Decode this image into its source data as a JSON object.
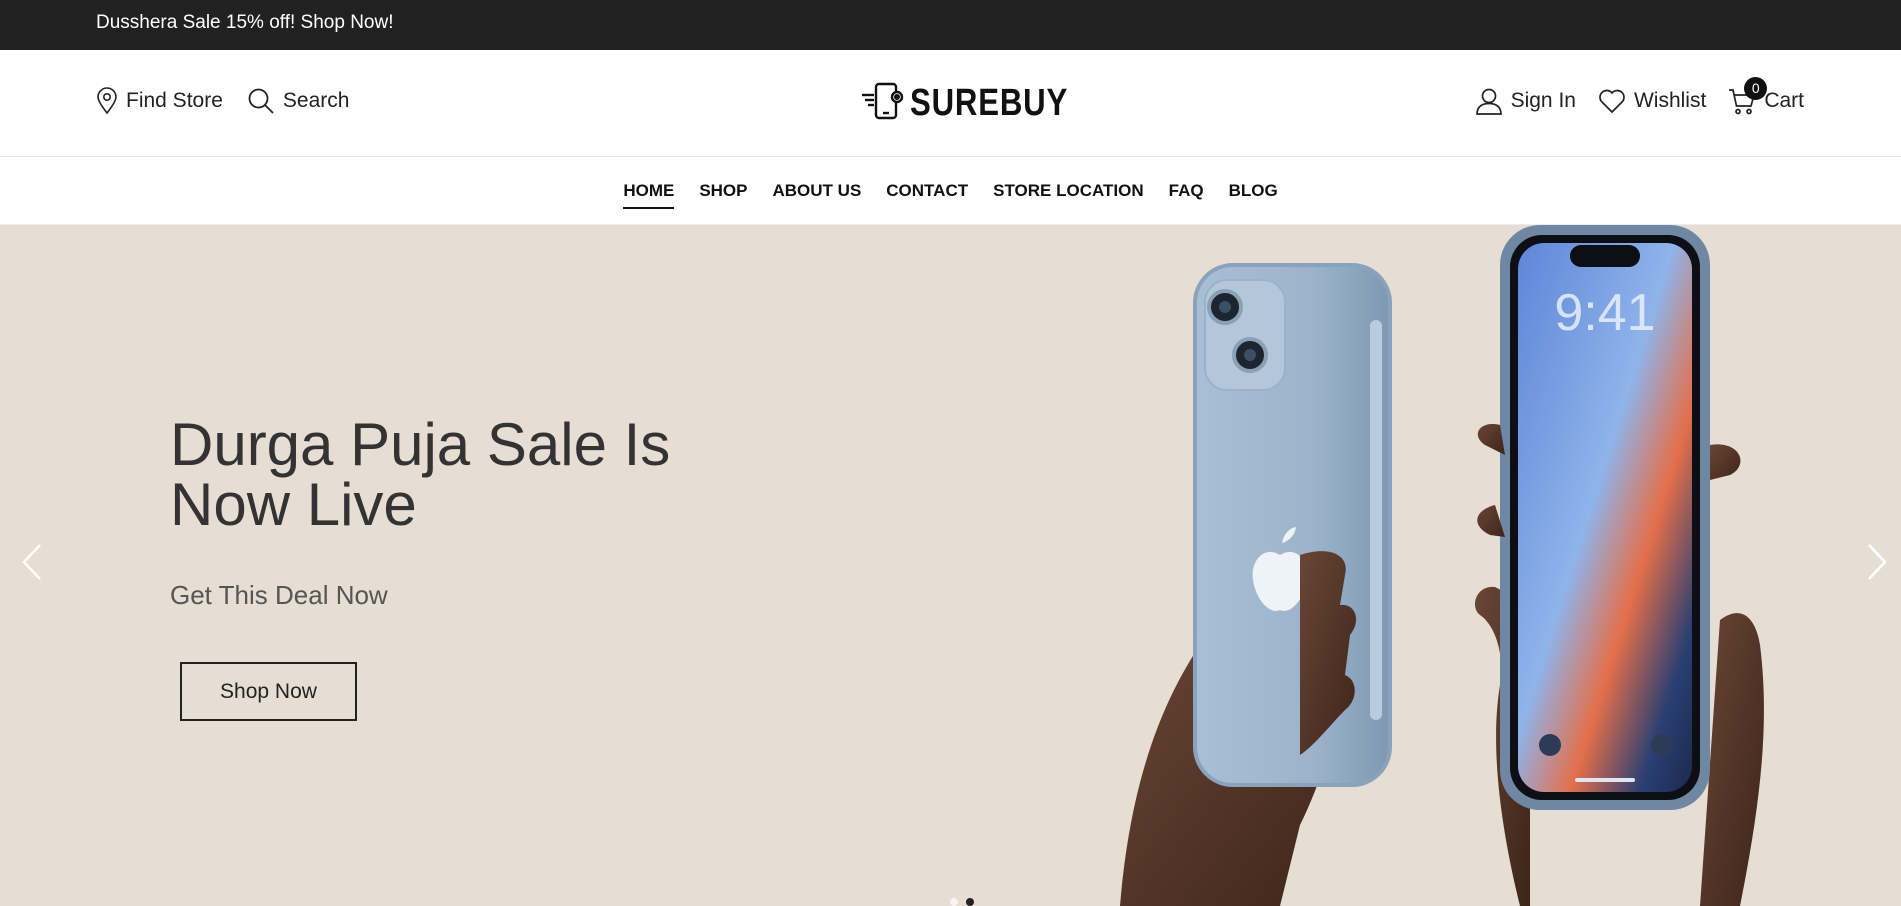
{
  "announcement": {
    "text": "Dusshera Sale 15% off! Shop Now!"
  },
  "header": {
    "find_store": "Find Store",
    "search": "Search",
    "logo_text": "SUREBUY",
    "sign_in": "Sign In",
    "wishlist": "Wishlist",
    "cart": "Cart",
    "cart_count": "0"
  },
  "nav": {
    "items": [
      "HOME",
      "SHOP",
      "ABOUT US",
      "CONTACT",
      "STORE LOCATION",
      "FAQ",
      "BLOG"
    ],
    "active": "HOME"
  },
  "hero": {
    "title": "Durga Puja Sale Is Now Live",
    "subtitle": "Get This Deal Now",
    "button": "Shop Now",
    "background_color": "#e6ddd3",
    "slide_count": 2,
    "active_slide": 2
  },
  "icons": {
    "find_store": "map-pin-icon",
    "search": "search-icon",
    "sign_in": "user-icon",
    "wishlist": "heart-icon",
    "cart": "cart-icon",
    "prev": "chevron-left-icon",
    "next": "chevron-right-icon"
  }
}
